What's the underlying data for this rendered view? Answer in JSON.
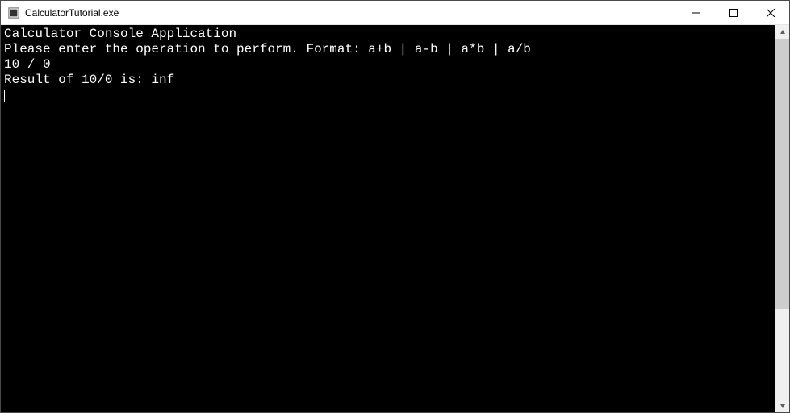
{
  "window": {
    "title": "CalculatorTutorial.exe"
  },
  "console": {
    "line1": "Calculator Console Application",
    "line2": "",
    "line3": "Please enter the operation to perform. Format: a+b | a-b | a*b | a/b",
    "line4": "10 / 0",
    "line5": "Result of 10/0 is: inf"
  }
}
